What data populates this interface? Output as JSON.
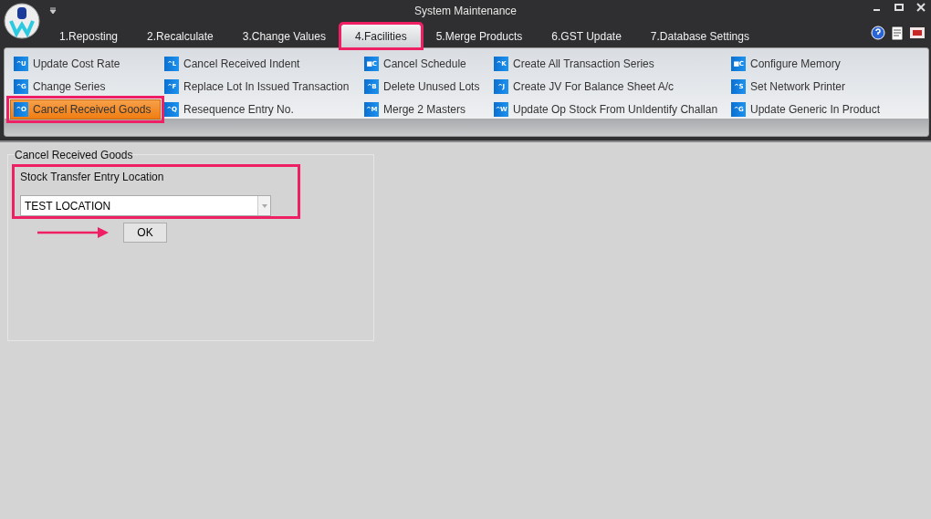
{
  "window": {
    "title": "System Maintenance"
  },
  "tabs": [
    {
      "label": "1.Reposting",
      "selected": false,
      "highlighted": false
    },
    {
      "label": "2.Recalculate",
      "selected": false,
      "highlighted": false
    },
    {
      "label": "3.Change Values",
      "selected": false,
      "highlighted": false
    },
    {
      "label": "4.Facilities",
      "selected": true,
      "highlighted": true
    },
    {
      "label": "5.Merge Products",
      "selected": false,
      "highlighted": false
    },
    {
      "label": "6.GST Update",
      "selected": false,
      "highlighted": false
    },
    {
      "label": "7.Database Settings",
      "selected": false,
      "highlighted": false
    }
  ],
  "ribbon": {
    "columns": [
      [
        {
          "shortcut": "^U",
          "label": "Update Cost Rate",
          "selected": false,
          "highlighted": false
        },
        {
          "shortcut": "^G",
          "label": "Change Series",
          "selected": false,
          "highlighted": false
        },
        {
          "shortcut": "^O",
          "label": "Cancel Received Goods",
          "selected": true,
          "highlighted": true
        }
      ],
      [
        {
          "shortcut": "^L",
          "label": "Cancel Received Indent",
          "selected": false,
          "highlighted": false
        },
        {
          "shortcut": "^F",
          "label": "Replace Lot In Issued Transaction",
          "selected": false,
          "highlighted": false
        },
        {
          "shortcut": "^Q",
          "label": "Resequence Entry No.",
          "selected": false,
          "highlighted": false
        }
      ],
      [
        {
          "shortcut": "■C",
          "label": "Cancel Schedule",
          "selected": false,
          "highlighted": false
        },
        {
          "shortcut": "^B",
          "label": "Delete Unused Lots",
          "selected": false,
          "highlighted": false
        },
        {
          "shortcut": "^M",
          "label": "Merge 2 Masters",
          "selected": false,
          "highlighted": false
        }
      ],
      [
        {
          "shortcut": "^K",
          "label": "Create All Transaction Series",
          "selected": false,
          "highlighted": false
        },
        {
          "shortcut": "^J",
          "label": "Create JV For Balance Sheet A/c",
          "selected": false,
          "highlighted": false
        },
        {
          "shortcut": "^W",
          "label": "Update Op Stock From UnIdentify Challan",
          "selected": false,
          "highlighted": false
        }
      ],
      [
        {
          "shortcut": "■C",
          "label": "Configure Memory",
          "selected": false,
          "highlighted": false
        },
        {
          "shortcut": "^S",
          "label": "Set Network Printer",
          "selected": false,
          "highlighted": false
        },
        {
          "shortcut": "^G",
          "label": "Update Generic In Product",
          "selected": false,
          "highlighted": false
        }
      ]
    ]
  },
  "form": {
    "title": "Cancel Received Goods",
    "field_label": "Stock Transfer Entry Location",
    "field_value": "TEST LOCATION",
    "field_highlighted": true,
    "button": "OK"
  }
}
